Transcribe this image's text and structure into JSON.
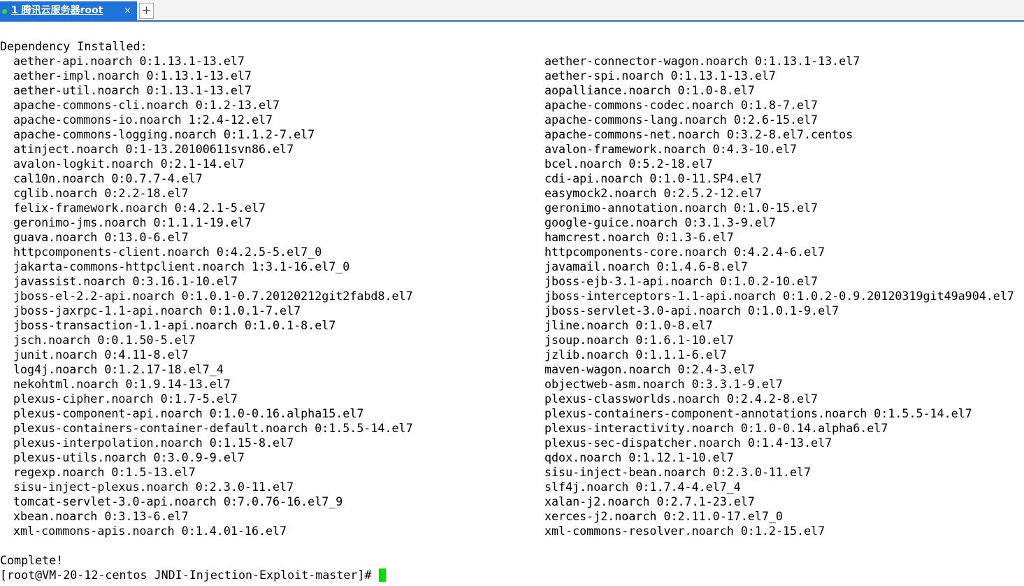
{
  "tabs": [
    {
      "label": "1 腾讯云服务器root",
      "close": "×",
      "active": true
    }
  ],
  "new_tab_label": "+",
  "terminal": {
    "header": "Dependency Installed:",
    "packages": [
      [
        "aether-api.noarch 0:1.13.1-13.el7",
        "aether-connector-wagon.noarch 0:1.13.1-13.el7"
      ],
      [
        "aether-impl.noarch 0:1.13.1-13.el7",
        "aether-spi.noarch 0:1.13.1-13.el7"
      ],
      [
        "aether-util.noarch 0:1.13.1-13.el7",
        "aopalliance.noarch 0:1.0-8.el7"
      ],
      [
        "apache-commons-cli.noarch 0:1.2-13.el7",
        "apache-commons-codec.noarch 0:1.8-7.el7"
      ],
      [
        "apache-commons-io.noarch 1:2.4-12.el7",
        "apache-commons-lang.noarch 0:2.6-15.el7"
      ],
      [
        "apache-commons-logging.noarch 0:1.1.2-7.el7",
        "apache-commons-net.noarch 0:3.2-8.el7.centos"
      ],
      [
        "atinject.noarch 0:1-13.20100611svn86.el7",
        "avalon-framework.noarch 0:4.3-10.el7"
      ],
      [
        "avalon-logkit.noarch 0:2.1-14.el7",
        "bcel.noarch 0:5.2-18.el7"
      ],
      [
        "cal10n.noarch 0:0.7.7-4.el7",
        "cdi-api.noarch 0:1.0-11.SP4.el7"
      ],
      [
        "cglib.noarch 0:2.2-18.el7",
        "easymock2.noarch 0:2.5.2-12.el7"
      ],
      [
        "felix-framework.noarch 0:4.2.1-5.el7",
        "geronimo-annotation.noarch 0:1.0-15.el7"
      ],
      [
        "geronimo-jms.noarch 0:1.1.1-19.el7",
        "google-guice.noarch 0:3.1.3-9.el7"
      ],
      [
        "guava.noarch 0:13.0-6.el7",
        "hamcrest.noarch 0:1.3-6.el7"
      ],
      [
        "httpcomponents-client.noarch 0:4.2.5-5.el7_0",
        "httpcomponents-core.noarch 0:4.2.4-6.el7"
      ],
      [
        "jakarta-commons-httpclient.noarch 1:3.1-16.el7_0",
        "javamail.noarch 0:1.4.6-8.el7"
      ],
      [
        "javassist.noarch 0:3.16.1-10.el7",
        "jboss-ejb-3.1-api.noarch 0:1.0.2-10.el7"
      ],
      [
        "jboss-el-2.2-api.noarch 0:1.0.1-0.7.20120212git2fabd8.el7",
        "jboss-interceptors-1.1-api.noarch 0:1.0.2-0.9.20120319git49a904.el7"
      ],
      [
        "jboss-jaxrpc-1.1-api.noarch 0:1.0.1-7.el7",
        "jboss-servlet-3.0-api.noarch 0:1.0.1-9.el7"
      ],
      [
        "jboss-transaction-1.1-api.noarch 0:1.0.1-8.el7",
        "jline.noarch 0:1.0-8.el7"
      ],
      [
        "jsch.noarch 0:0.1.50-5.el7",
        "jsoup.noarch 0:1.6.1-10.el7"
      ],
      [
        "junit.noarch 0:4.11-8.el7",
        "jzlib.noarch 0:1.1.1-6.el7"
      ],
      [
        "log4j.noarch 0:1.2.17-18.el7_4",
        "maven-wagon.noarch 0:2.4-3.el7"
      ],
      [
        "nekohtml.noarch 0:1.9.14-13.el7",
        "objectweb-asm.noarch 0:3.3.1-9.el7"
      ],
      [
        "plexus-cipher.noarch 0:1.7-5.el7",
        "plexus-classworlds.noarch 0:2.4.2-8.el7"
      ],
      [
        "plexus-component-api.noarch 0:1.0-0.16.alpha15.el7",
        "plexus-containers-component-annotations.noarch 0:1.5.5-14.el7"
      ],
      [
        "plexus-containers-container-default.noarch 0:1.5.5-14.el7",
        "plexus-interactivity.noarch 0:1.0-0.14.alpha6.el7"
      ],
      [
        "plexus-interpolation.noarch 0:1.15-8.el7",
        "plexus-sec-dispatcher.noarch 0:1.4-13.el7"
      ],
      [
        "plexus-utils.noarch 0:3.0.9-9.el7",
        "qdox.noarch 0:1.12.1-10.el7"
      ],
      [
        "regexp.noarch 0:1.5-13.el7",
        "sisu-inject-bean.noarch 0:2.3.0-11.el7"
      ],
      [
        "sisu-inject-plexus.noarch 0:2.3.0-11.el7",
        "slf4j.noarch 0:1.7.4-4.el7_4"
      ],
      [
        "tomcat-servlet-3.0-api.noarch 0:7.0.76-16.el7_9",
        "xalan-j2.noarch 0:2.7.1-23.el7"
      ],
      [
        "xbean.noarch 0:3.13-6.el7",
        "xerces-j2.noarch 0:2.11.0-17.el7_0"
      ],
      [
        "xml-commons-apis.noarch 0:1.4.01-16.el7",
        "xml-commons-resolver.noarch 0:1.2-15.el7"
      ]
    ],
    "complete": "Complete!",
    "prompt": "[root@VM-20-12-centos JNDI-Injection-Exploit-master]# "
  },
  "colors": {
    "tab_active": "#1e72d8",
    "status_dot": "#3cd43c",
    "cursor": "#00e000"
  }
}
